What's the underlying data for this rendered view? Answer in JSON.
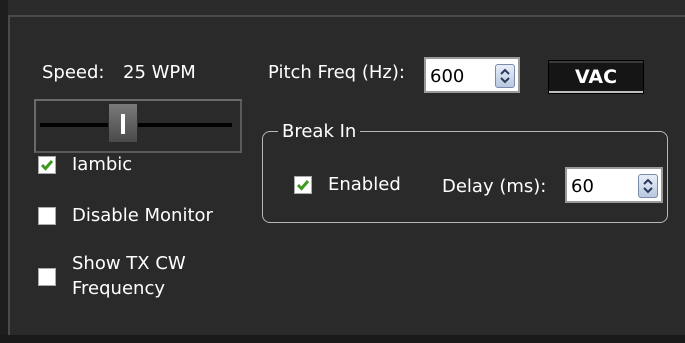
{
  "speed": {
    "label": "Speed:",
    "value": "25 WPM",
    "slider_position": 0.45
  },
  "pitch": {
    "label": "Pitch Freq (Hz):",
    "value": "600"
  },
  "vac_button": {
    "label": "VAC"
  },
  "iambic": {
    "label": "Iambic",
    "checked": true
  },
  "disable_monitor": {
    "label": "Disable Monitor",
    "checked": false
  },
  "show_tx_cw": {
    "line1": "Show TX CW",
    "line2": "Frequency",
    "checked": false
  },
  "break_in": {
    "title": "Break In",
    "enabled": {
      "label": "Enabled",
      "checked": true
    },
    "delay": {
      "label": "Delay (ms):",
      "value": "60"
    }
  },
  "colors": {
    "background": "#2a2a2a",
    "checkmark": "#3c9a1e",
    "text": "#ffffff"
  }
}
